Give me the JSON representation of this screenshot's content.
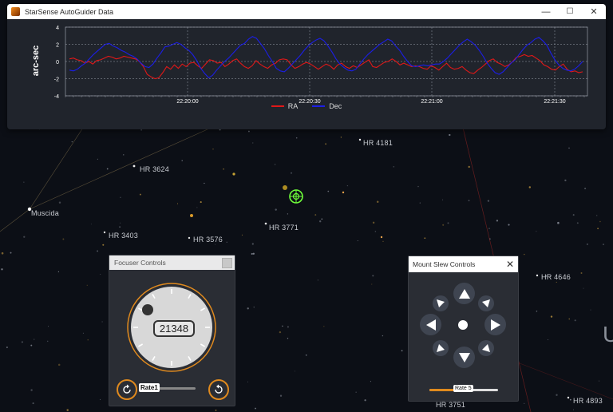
{
  "guider_window": {
    "title": "StarSense AutoGuider Data",
    "controls": {
      "minimize": "—",
      "maximize": "☐",
      "close": "✕"
    }
  },
  "chart_data": {
    "type": "line",
    "ylabel": "arc-sec",
    "ylim": [
      -4,
      4
    ],
    "yticks": [
      "4",
      "2",
      "0",
      "-2",
      "-4"
    ],
    "xticks": [
      "22:20:00",
      "22:20:30",
      "22:21:00",
      "22:21:30"
    ],
    "legend_position": "bottom-center",
    "grid": true,
    "series": [
      {
        "name": "RA",
        "color": "#e01818",
        "values": [
          0.3,
          0.4,
          0.2,
          0.1,
          -0.2,
          0.0,
          -0.3,
          0.1,
          0.2,
          0.4,
          0.6,
          0.5,
          0.3,
          0.4,
          0.6,
          0.5,
          0.4,
          0.3,
          0.0,
          -0.6,
          -1.5,
          -1.8,
          -2.0,
          -1.9,
          -1.3,
          -0.6,
          -0.9,
          -0.4,
          -0.8,
          -0.3,
          -0.6,
          -0.2,
          -0.1,
          -0.5,
          -0.8,
          -0.3,
          0.2,
          0.1,
          -0.2,
          -0.1,
          -0.6,
          -0.3,
          0.1,
          0.3,
          -0.2,
          -0.6,
          -0.8,
          -0.5,
          0.1,
          -0.3,
          -0.6,
          -0.8,
          -0.4,
          -0.2,
          0.2,
          0.3,
          0.2,
          -0.4,
          -0.8,
          -0.6,
          -0.3,
          -0.1,
          -0.3,
          -0.6,
          -0.9,
          -0.6,
          -0.3,
          -0.5,
          -0.9,
          -0.4,
          -0.2,
          -0.6,
          -0.8,
          -0.5,
          -0.7,
          -0.4,
          -0.1,
          0.2,
          -0.6,
          -0.7,
          -0.4,
          -0.1,
          0.0,
          0.3,
          0.0,
          -0.4,
          -0.2,
          -0.4,
          -0.6,
          -0.5,
          -0.6,
          -0.8,
          -0.9,
          -0.5,
          -0.7,
          -1.0,
          -0.6,
          -0.2,
          -0.7,
          -0.9,
          -0.8,
          -0.6,
          -1.0,
          -1.3,
          -1.4,
          -1.0,
          -0.7,
          -0.3,
          0.1,
          0.3,
          -0.1,
          -0.3,
          -0.6,
          -0.4,
          0.0,
          0.5,
          0.6,
          0.8,
          0.6,
          0.7,
          0.4,
          0.1,
          -0.4,
          -0.6,
          -0.9,
          -1.0,
          -0.6,
          -0.3,
          -0.9,
          -1.2,
          -1.1,
          -1.3,
          -1.2
        ]
      },
      {
        "name": "Dec",
        "color": "#1c1ee6",
        "values": [
          -1.0,
          -1.1,
          -0.9,
          -0.5,
          -0.2,
          0.3,
          0.8,
          1.2,
          1.6,
          2.0,
          2.1,
          1.8,
          1.6,
          1.3,
          1.1,
          0.8,
          0.6,
          0.3,
          -0.2,
          -0.6,
          -0.7,
          -0.3,
          0.4,
          1.0,
          1.7,
          1.8,
          2.0,
          2.2,
          2.0,
          1.6,
          1.3,
          0.8,
          0.1,
          -0.8,
          -1.4,
          -1.9,
          -1.6,
          -1.0,
          -0.5,
          0.0,
          0.4,
          0.9,
          1.4,
          1.9,
          2.1,
          2.6,
          2.9,
          2.7,
          2.1,
          1.5,
          0.7,
          0.0,
          -0.8,
          -1.1,
          -1.2,
          -0.8,
          -0.3,
          0.2,
          0.7,
          1.3,
          1.8,
          2.2,
          2.5,
          2.7,
          2.4,
          1.8,
          1.1,
          0.3,
          -0.3,
          -0.7,
          -1.0,
          -1.1,
          -0.9,
          -0.3,
          0.3,
          0.8,
          1.2,
          1.6,
          2.0,
          2.3,
          2.6,
          2.4,
          1.8,
          1.3,
          0.6,
          0.0,
          -0.5,
          -0.6,
          -0.5,
          -0.4,
          -0.5,
          -0.4,
          -0.3,
          -0.3,
          0.0,
          0.4,
          0.9,
          1.4,
          1.9,
          2.3,
          2.6,
          2.3,
          1.9,
          1.3,
          0.6,
          -0.2,
          -0.8,
          -1.3,
          -1.5,
          -1.2,
          -0.7,
          -0.2,
          0.2,
          0.8,
          1.4,
          1.9,
          2.2,
          2.6,
          2.8,
          2.4,
          1.9,
          1.0,
          0.2,
          -0.4,
          -0.8,
          -1.0,
          -1.1,
          -0.9,
          -0.5,
          0.0
        ]
      }
    ]
  },
  "star_labels": [
    "HR 4181",
    "HR 3624",
    "Muscida",
    "HR 3403",
    "HR 3576",
    "HR 3771",
    "HR 4646",
    "HR 3751",
    "HR 4893"
  ],
  "focuser": {
    "title": "Focuser Controls",
    "position_value": "21348",
    "rate_label": "Rate1",
    "rate_level": 0.0
  },
  "mount": {
    "title": "Mount Slew Controls",
    "close": "✕",
    "rate_label": "Rate 5",
    "rate_level": 0.5
  },
  "colors": {
    "accent": "#e08a1e",
    "ra": "#e01818",
    "dec": "#1c1ee6",
    "reticle": "#6fff3a"
  }
}
